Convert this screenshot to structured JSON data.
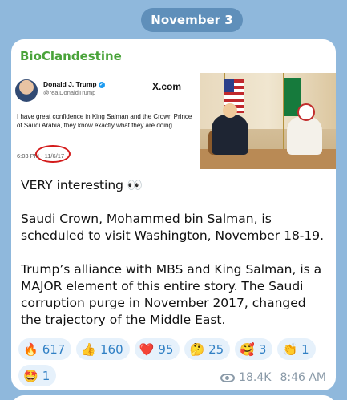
{
  "date_separator": "November 3",
  "message": {
    "channel_name": "BioClandestine",
    "embedded_tweet": {
      "author_name": "Donald J. Trump",
      "author_handle": "@realDonaldTrump",
      "platform_logo": "X.com",
      "text": "I have great confidence in King Salman and the Crown Prince of Saudi Arabia, they know exactly what they are doing....",
      "time": "6:03 PM",
      "date": "11/6/17",
      "highlight_color": "#d31a1a"
    },
    "paragraphs": [
      "VERY interesting 👀",
      "Saudi Crown, Mohammed bin Salman, is scheduled to visit Washington, November 18-19.",
      "Trump’s alliance with MBS and King Salman, is a MAJOR element of this entire story. The Saudi corruption purge in November 2017, changed the trajectory of the Middle East."
    ],
    "reactions": [
      {
        "emoji": "🔥",
        "icon": "fire-icon",
        "count": "617"
      },
      {
        "emoji": "👍",
        "icon": "thumbs-up-icon",
        "count": "160"
      },
      {
        "emoji": "❤️",
        "icon": "heart-icon",
        "count": "95"
      },
      {
        "emoji": "🤔",
        "icon": "thinking-face-icon",
        "count": "25"
      },
      {
        "emoji": "🥰",
        "icon": "smiling-face-hearts-icon",
        "count": "3"
      },
      {
        "emoji": "👏",
        "icon": "clapping-hands-icon",
        "count": "1"
      },
      {
        "emoji": "🤩",
        "icon": "star-struck-icon",
        "count": "1"
      }
    ],
    "views": "18.4K",
    "time": "8:46 AM"
  },
  "colors": {
    "background": "#8fb8dc",
    "channel_name": "#4aa33a",
    "reaction_bg": "#e6f1fb",
    "reaction_text": "#2f7fc4"
  }
}
